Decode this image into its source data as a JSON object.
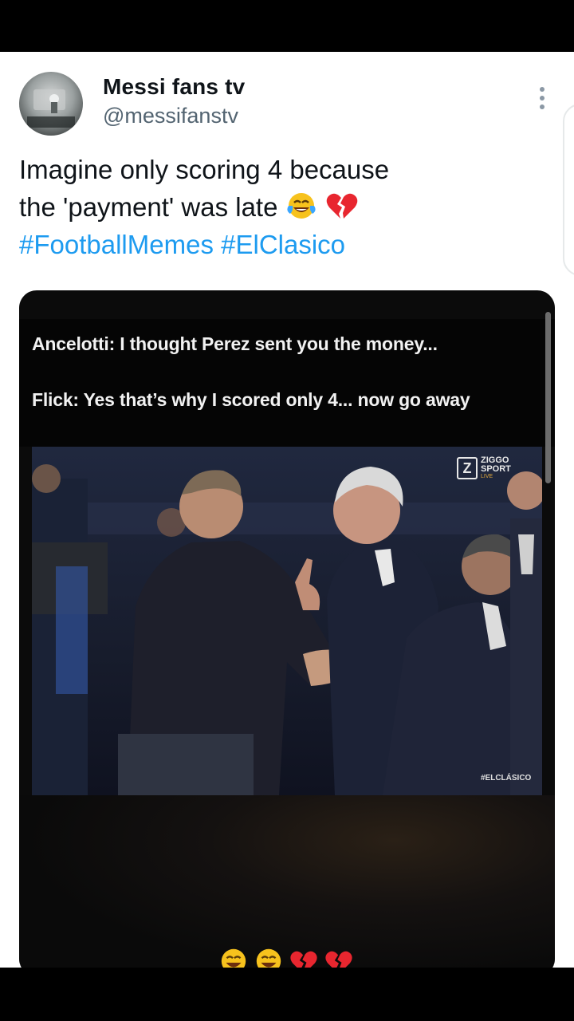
{
  "tweet": {
    "author": {
      "display_name": "Messi fans tv",
      "handle": "@messifanstv"
    },
    "text_line1": "Imagine only scoring 4 because",
    "text_line2": "the 'payment' was late",
    "hashtags": [
      "#FootballMemes",
      "#ElClasico"
    ],
    "line2_emojis": [
      "face-with-tears-of-joy-icon",
      "broken-heart-icon"
    ]
  },
  "media": {
    "caption_line1": "Ancelotti: I thought Perez sent you the money...",
    "caption_line2": "Flick: Yes that’s why I scored only 4... now go away",
    "watermark": {
      "logo": "Z",
      "line1": "ZIGGO",
      "line2": "SPORT",
      "line3": "LIVE"
    },
    "corner_tag": "#ELCLÁSICO",
    "bottom_emojis": [
      "face-with-tears-of-joy-icon",
      "face-with-tears-of-joy-icon",
      "broken-heart-icon",
      "broken-heart-icon"
    ]
  },
  "colors": {
    "link": "#1d9bf0",
    "text": "#0f1419",
    "secondary": "#536471"
  }
}
